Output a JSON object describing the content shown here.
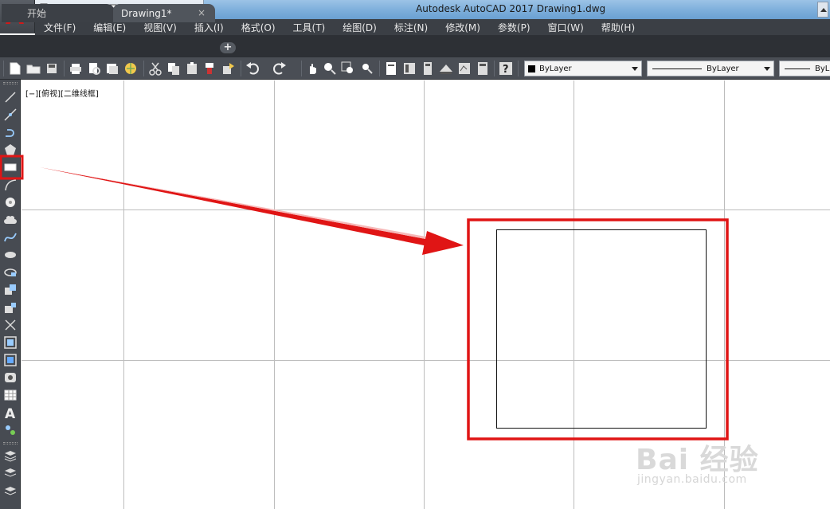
{
  "window": {
    "title": "Autodesk AutoCAD 2017    Drawing1.dwg",
    "app_logo": "A"
  },
  "quick_access": {
    "icons": [
      "new-icon",
      "open-icon",
      "save-icon",
      "save-as-icon",
      "print-icon",
      "undo-icon",
      "redo-icon",
      "customize-icon"
    ]
  },
  "menu": {
    "items": [
      "文件(F)",
      "编辑(E)",
      "视图(V)",
      "插入(I)",
      "格式(O)",
      "工具(T)",
      "绘图(D)",
      "标注(N)",
      "修改(M)",
      "参数(P)",
      "窗口(W)",
      "帮助(H)"
    ]
  },
  "tabs": {
    "items": [
      {
        "label": "开始"
      },
      {
        "label": "Drawing1*",
        "close": "×"
      }
    ],
    "add": "+"
  },
  "toolbar": {
    "color_combo": "ByLayer",
    "linetype_combo": "ByLayer",
    "lineweight_combo": "ByL"
  },
  "viewport": {
    "label": "[−][俯视][二维线框]"
  },
  "drawing": {
    "shape": "rectangle",
    "highlight_color": "#e01515",
    "annotation": "arrow from rectangle tool to drawn rectangle"
  },
  "watermark": {
    "text": "Bai 经验",
    "url": "jingyan.baidu.com"
  },
  "colors": {
    "menu_bg": "#3b3f45",
    "canvas_bg": "#ffffff",
    "grid": "#bdbdbd",
    "highlight": "#e01515"
  }
}
